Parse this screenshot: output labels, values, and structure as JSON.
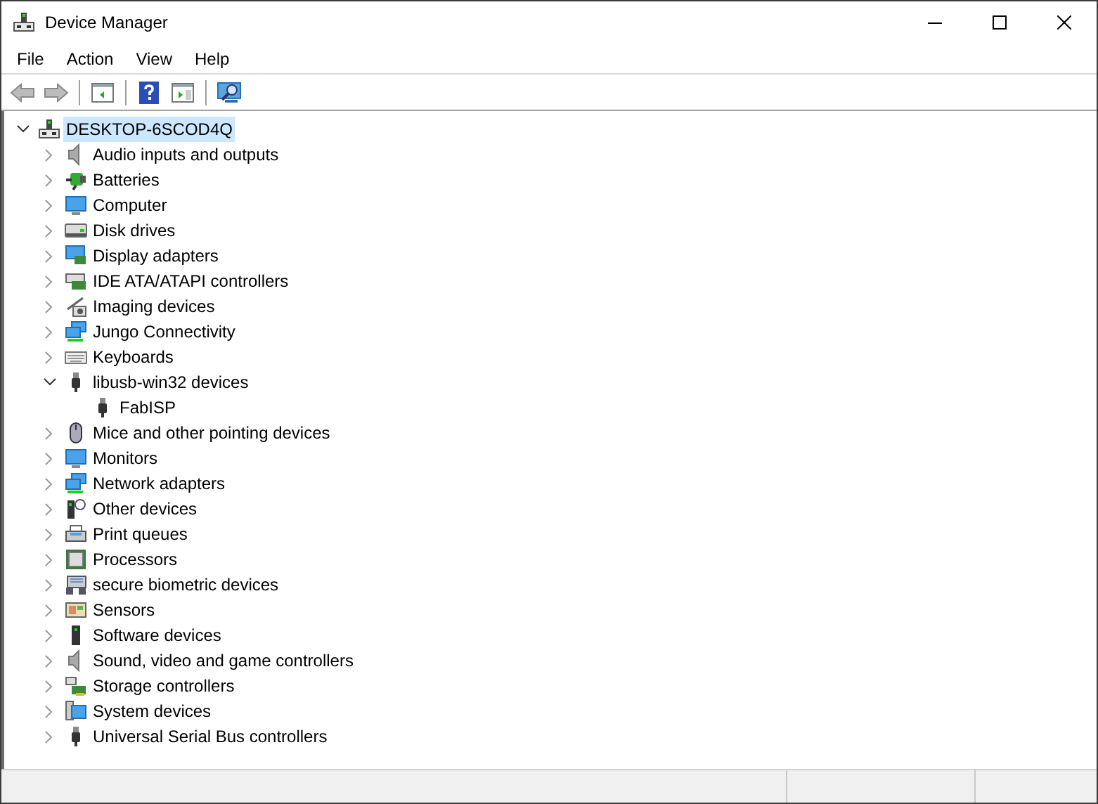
{
  "window": {
    "title": "Device Manager"
  },
  "menu": [
    {
      "label": "File"
    },
    {
      "label": "Action"
    },
    {
      "label": "View"
    },
    {
      "label": "Help"
    }
  ],
  "tree": {
    "label": "DESKTOP-6SCOD4Q",
    "expanded": true,
    "selected": true,
    "children": [
      {
        "label": "Audio inputs and outputs",
        "expanded": false,
        "selected": false
      },
      {
        "label": "Batteries",
        "expanded": false,
        "selected": false
      },
      {
        "label": "Computer",
        "expanded": false,
        "selected": false
      },
      {
        "label": "Disk drives",
        "expanded": false,
        "selected": false
      },
      {
        "label": "Display adapters",
        "expanded": false,
        "selected": false
      },
      {
        "label": "IDE ATA/ATAPI controllers",
        "expanded": false,
        "selected": false
      },
      {
        "label": "Imaging devices",
        "expanded": false,
        "selected": false
      },
      {
        "label": "Jungo Connectivity",
        "expanded": false,
        "selected": false
      },
      {
        "label": "Keyboards",
        "expanded": false,
        "selected": false
      },
      {
        "label": "libusb-win32 devices",
        "expanded": true,
        "selected": false,
        "children": [
          {
            "label": "FabISP",
            "selected": false
          }
        ]
      },
      {
        "label": "Mice and other pointing devices",
        "expanded": false,
        "selected": false
      },
      {
        "label": "Monitors",
        "expanded": false,
        "selected": false
      },
      {
        "label": "Network adapters",
        "expanded": false,
        "selected": false
      },
      {
        "label": "Other devices",
        "expanded": false,
        "selected": false
      },
      {
        "label": "Print queues",
        "expanded": false,
        "selected": false
      },
      {
        "label": "Processors",
        "expanded": false,
        "selected": false
      },
      {
        "label": "secure biometric devices",
        "expanded": false,
        "selected": false
      },
      {
        "label": "Sensors",
        "expanded": false,
        "selected": false
      },
      {
        "label": "Software devices",
        "expanded": false,
        "selected": false
      },
      {
        "label": "Sound, video and game controllers",
        "expanded": false,
        "selected": false
      },
      {
        "label": "Storage controllers",
        "expanded": false,
        "selected": false
      },
      {
        "label": "System devices",
        "expanded": false,
        "selected": false
      },
      {
        "label": "Universal Serial Bus controllers",
        "expanded": false,
        "selected": false
      }
    ]
  }
}
